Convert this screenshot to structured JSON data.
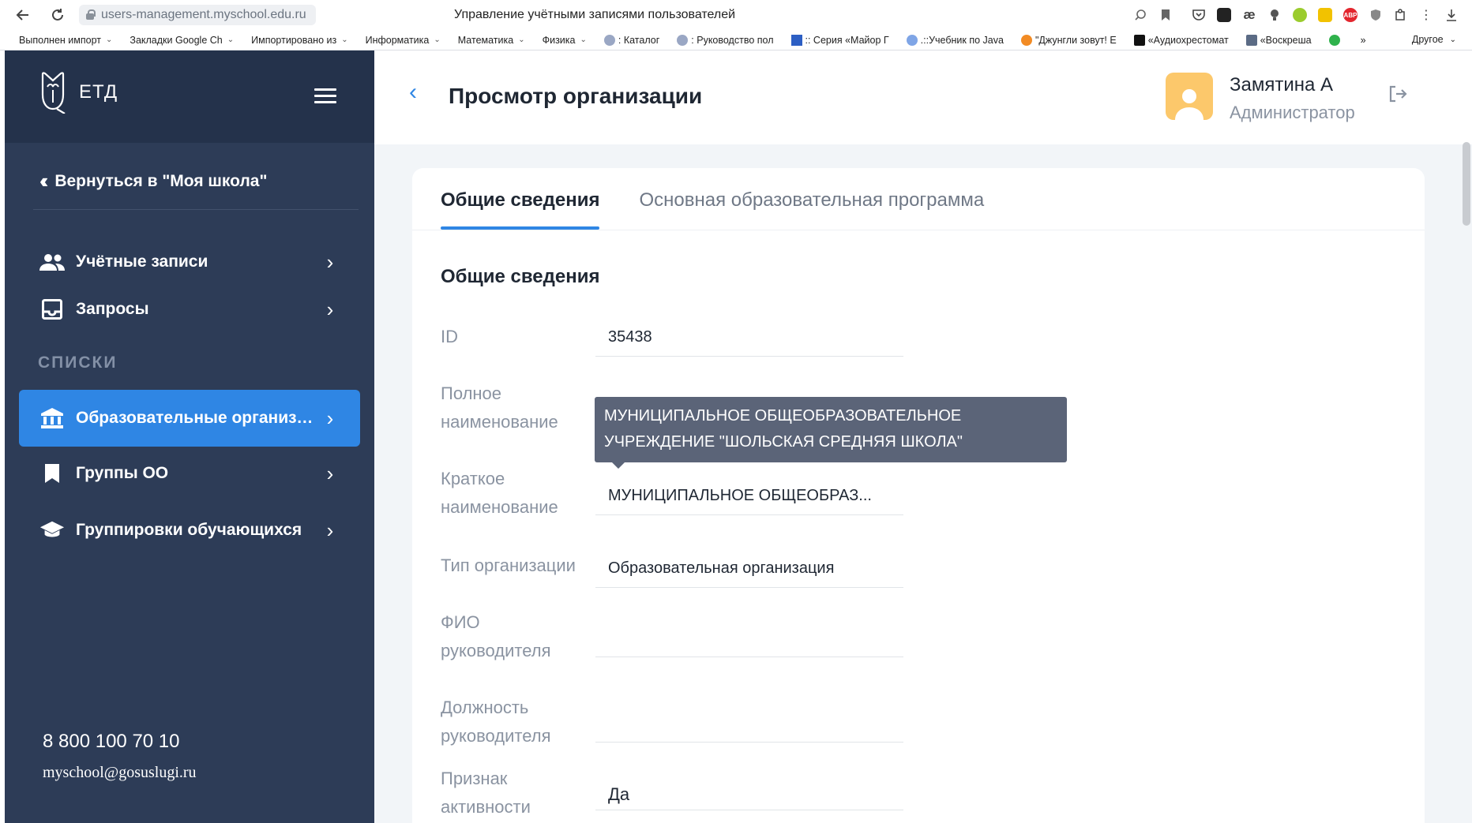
{
  "browser": {
    "url": "users-management.myschool.edu.ru",
    "tab_title": "Управление учётными записями пользователей",
    "bookmarks": [
      {
        "label": "Выполнен импорт",
        "caret": true
      },
      {
        "label": "Закладки Google Ch",
        "caret": true
      },
      {
        "label": "Импортировано из",
        "caret": true
      },
      {
        "label": "Информатика",
        "caret": true
      },
      {
        "label": "Математика",
        "caret": true
      },
      {
        "label": "Физика",
        "caret": true
      },
      {
        "label": ": Каталог",
        "caret": false
      },
      {
        "label": ": Руководство пол",
        "caret": false
      },
      {
        "label": ":: Серия «Майор Г",
        "caret": false
      },
      {
        "label": ".::Учебник по Java",
        "caret": false
      },
      {
        "label": "\"Джунгли зовут! Е",
        "caret": false
      },
      {
        "label": "«Аудиохрестомат",
        "caret": false
      },
      {
        "label": "«Воскреша",
        "caret": false
      }
    ],
    "more_label": "»",
    "other_label": "Другое"
  },
  "sidebar": {
    "logo_text": "ЕТД",
    "back_label": "Вернуться в \"Моя школа\"",
    "items": [
      {
        "label": "Учётные записи"
      },
      {
        "label": "Запросы"
      }
    ],
    "section_label": "СПИСКИ",
    "list_items": [
      {
        "label": "Образовательные организа..."
      },
      {
        "label": "Группы ОО"
      },
      {
        "label": "Группировки обучающихся"
      }
    ],
    "phone": "8 800 100 70 10",
    "email": "myschool@gosuslugi.ru"
  },
  "header": {
    "title": "Просмотр организации",
    "user_name": "Замятина А",
    "user_role": "Администратор"
  },
  "tabs": [
    {
      "label": "Общие сведения"
    },
    {
      "label": "Основная образовательная программа"
    }
  ],
  "section_title": "Общие сведения",
  "fields": {
    "id": {
      "label": "ID",
      "value": "35438"
    },
    "full_name": {
      "label1": "Полное",
      "label2": "наименование",
      "value": ""
    },
    "short_name": {
      "label1": "Краткое",
      "label2": "наименование",
      "value": "МУНИЦИПАЛЬНОЕ ОБЩЕОБРАЗ..."
    },
    "org_type": {
      "label": "Тип организации",
      "value": "Образовательная организация"
    },
    "director_name": {
      "label1": "ФИО",
      "label2": "руководителя",
      "value": ""
    },
    "director_position": {
      "label1": "Должность",
      "label2": "руководителя",
      "value": ""
    },
    "active": {
      "label1": "Признак",
      "label2": "активности",
      "value": "Да"
    }
  },
  "tooltip": {
    "line1": "МУНИЦИПАЛЬНОЕ ОБЩЕОБРАЗОВАТЕЛЬНОЕ",
    "line2": "УЧРЕЖДЕНИЕ \"ШОЛЬСКАЯ СРЕДНЯЯ ШКОЛА\""
  },
  "colors": {
    "sidebar_bg": "#2d3c57",
    "accent": "#2f86e4",
    "avatar": "#fcc86b"
  }
}
